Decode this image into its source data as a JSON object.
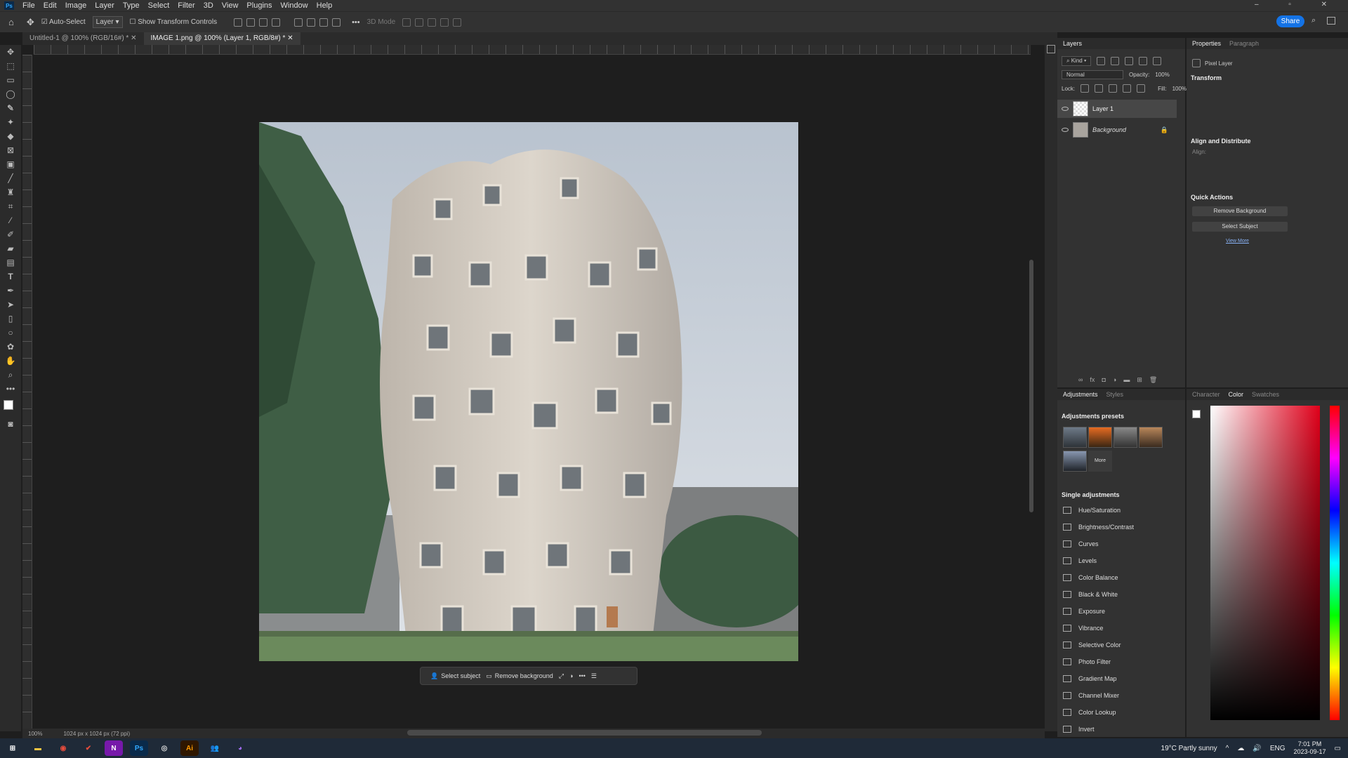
{
  "menu": [
    "File",
    "Edit",
    "Image",
    "Layer",
    "Type",
    "Select",
    "Filter",
    "3D",
    "View",
    "Plugins",
    "Window",
    "Help"
  ],
  "options": {
    "auto_select": "Auto-Select",
    "layer_select": "Layer",
    "transform": "Show Transform Controls",
    "mode3d": "3D Mode",
    "share": "Share"
  },
  "tabs": [
    "Untitled-1 @ 100% (RGB/16#) *",
    "IMAGE 1.png @ 100% (Layer 1, RGB/8#) *"
  ],
  "tools": [
    "move",
    "artboard",
    "marquee",
    "lasso",
    "quick-select",
    "wand",
    "crop",
    "frame",
    "eyedropper",
    "heal",
    "brush",
    "stamp",
    "history",
    "eraser",
    "gradient",
    "blur",
    "dodge",
    "pen",
    "type",
    "path-select",
    "rectangle",
    "hand",
    "zoom",
    "more"
  ],
  "context_bar": {
    "select_subject": "Select subject",
    "remove_background": "Remove background"
  },
  "status": {
    "zoom": "100%",
    "size": "1024 px x 1024 px (72 ppi)"
  },
  "layers_panel": {
    "title": "Layers",
    "kind": "Kind",
    "blend": "Normal",
    "opacity_label": "Opacity:",
    "opacity": "100%",
    "lock_label": "Lock:",
    "fill_label": "Fill:",
    "fill": "100%",
    "layers": [
      {
        "name": "Layer 1"
      },
      {
        "name": "Background"
      }
    ]
  },
  "properties_panel": {
    "tabs": [
      "Properties",
      "Paragraph"
    ],
    "type": "Pixel Layer",
    "transform": "Transform",
    "align": "Align and Distribute",
    "align_label": "Align:",
    "quick_actions": "Quick Actions",
    "remove_bg": "Remove Background",
    "select_subject": "Select Subject",
    "view_more": "View More"
  },
  "adjustments_panel": {
    "tabs": [
      "Adjustments",
      "Styles"
    ],
    "presets": "Adjustments presets",
    "more": "More",
    "single": "Single adjustments",
    "items": [
      "Hue/Saturation",
      "Brightness/Contrast",
      "Curves",
      "Levels",
      "Color Balance",
      "Black & White",
      "Exposure",
      "Vibrance",
      "Selective Color",
      "Photo Filter",
      "Gradient Map",
      "Channel Mixer",
      "Color Lookup",
      "Invert"
    ]
  },
  "color_panel": {
    "tabs": [
      "Character",
      "Color",
      "Swatches"
    ]
  },
  "taskbar": {
    "weather": "19°C  Partly sunny",
    "lang": "ENG",
    "time": "7:01 PM",
    "date": "2023-09-17"
  }
}
